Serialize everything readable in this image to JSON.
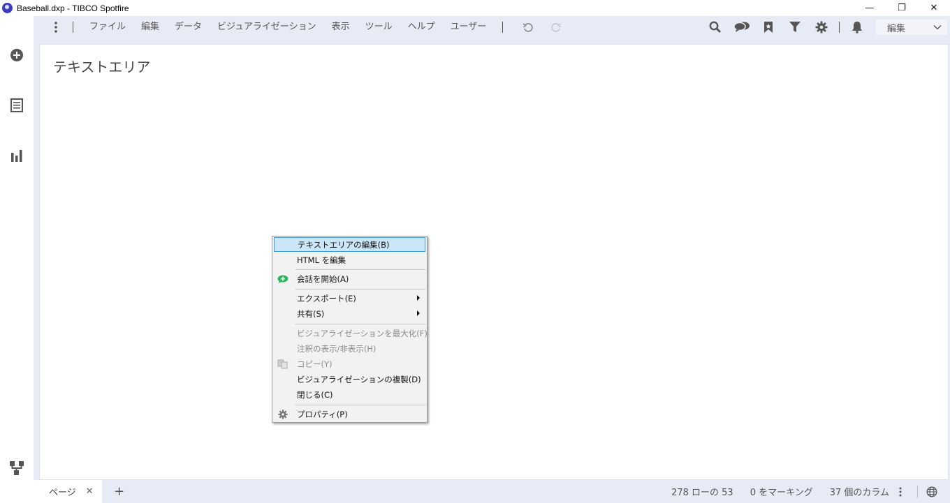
{
  "window": {
    "title": "Baseball.dxp - TIBCO Spotfire",
    "minimize": "—",
    "maximize": "❐",
    "close": "✕"
  },
  "leftrail": {
    "add_icon": "plus-circle-icon",
    "files_icon": "list-icon",
    "viz_icon": "bar-chart-icon",
    "data_canvas_icon": "data-flow-icon"
  },
  "menubar": {
    "items": [
      "ファイル",
      "編集",
      "データ",
      "ビジュアライゼーション",
      "表示",
      "ツール",
      "ヘルプ",
      "ユーザー"
    ],
    "mode_value": "編集"
  },
  "page": {
    "viz_title": "テキストエリア"
  },
  "bottombar": {
    "tab_label": "ページ",
    "tab_close": "✕",
    "add_page": "+",
    "rows_status": "278 ローの 53",
    "marking_status": "0 をマーキング",
    "columns_status": "37 個のカラム"
  },
  "context_menu": {
    "items": [
      {
        "label": "テキストエリアの編集(B)",
        "state": "selected"
      },
      {
        "label": "HTML を編集",
        "state": "enabled"
      },
      {
        "label": "会話を開始(A)",
        "state": "enabled",
        "icon": "chat-plus-icon"
      },
      {
        "label": "エクスポート(E)",
        "state": "enabled",
        "submenu": true
      },
      {
        "label": "共有(S)",
        "state": "enabled",
        "submenu": true
      },
      {
        "label": "ビジュアライゼーションを最大化(F)",
        "state": "disabled"
      },
      {
        "label": "注釈の表示/非表示(H)",
        "state": "disabled"
      },
      {
        "label": "コピー(Y)",
        "state": "disabled",
        "icon": "copy-icon"
      },
      {
        "label": "ビジュアライゼーションの複製(D)",
        "state": "enabled"
      },
      {
        "label": "閉じる(C)",
        "state": "enabled"
      },
      {
        "label": "プロパティ(P)",
        "state": "enabled",
        "icon": "gear-icon"
      }
    ]
  },
  "colors": {
    "accent_chrome": "#e7ebf5",
    "menu_highlight": "#cbe6f7",
    "menu_highlight_border": "#3f9bd8",
    "chat_icon": "#2fb35a"
  }
}
